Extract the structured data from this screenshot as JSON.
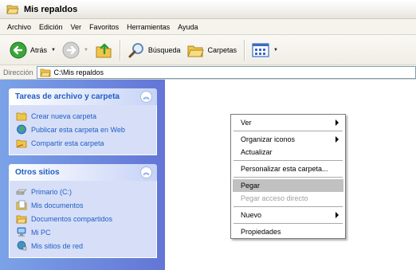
{
  "window": {
    "title": "Mis repaldos",
    "title_icon": "folder-open-icon"
  },
  "menubar": {
    "items": [
      "Archivo",
      "Edición",
      "Ver",
      "Favoritos",
      "Herramientas",
      "Ayuda"
    ]
  },
  "toolbar": {
    "back_label": "Atrás",
    "search_label": "Búsqueda",
    "folders_label": "Carpetas"
  },
  "address": {
    "label": "Dirección",
    "value": "C:\\Mis repaldos"
  },
  "taskpane": {
    "file_tasks": {
      "title": "Tareas de archivo y carpeta",
      "items": [
        {
          "label": "Crear nueva carpeta",
          "icon": "new-folder-icon"
        },
        {
          "label": "Publicar esta carpeta en Web",
          "icon": "globe-icon"
        },
        {
          "label": "Compartir esta carpeta",
          "icon": "share-folder-icon"
        }
      ]
    },
    "other_places": {
      "title": "Otros sitios",
      "items": [
        {
          "label": "Primario (C:)",
          "icon": "drive-icon"
        },
        {
          "label": "Mis documentos",
          "icon": "documents-icon"
        },
        {
          "label": "Documentos compartidos",
          "icon": "shared-folder-icon"
        },
        {
          "label": "Mi PC",
          "icon": "computer-icon"
        },
        {
          "label": "Mis sitios de red",
          "icon": "network-icon"
        }
      ]
    }
  },
  "context_menu": {
    "items": [
      {
        "label": "Ver",
        "submenu": true
      },
      {
        "label": "Organizar iconos",
        "submenu": true
      },
      {
        "label": "Actualizar"
      },
      {
        "label": "Personalizar esta carpeta..."
      },
      {
        "label": "Pegar",
        "highlighted": true
      },
      {
        "label": "Pegar acceso directo",
        "disabled": true
      },
      {
        "label": "Nuevo",
        "submenu": true
      },
      {
        "label": "Propiedades"
      }
    ]
  },
  "colors": {
    "taskpane_gradient_start": "#7ba2e7",
    "taskpane_gradient_end": "#6375d6",
    "link_blue": "#215dc6",
    "panel_body": "#d6dff7",
    "menu_highlight": "#c1c1c1"
  }
}
